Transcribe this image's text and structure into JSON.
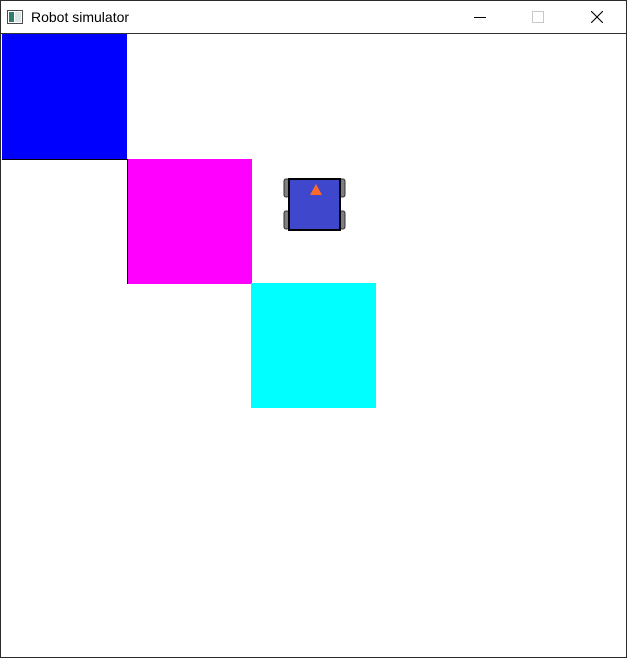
{
  "window": {
    "title": "Robot simulator",
    "controls": {
      "minimize": "minimize-icon",
      "maximize": "maximize-icon",
      "close": "close-icon"
    }
  },
  "world": {
    "tiles": [
      {
        "name": "blue",
        "color": "#0000ff"
      },
      {
        "name": "magenta",
        "color": "#ff00ff"
      },
      {
        "name": "cyan",
        "color": "#00ffff"
      }
    ],
    "robot": {
      "body_color": "#3f48cc",
      "wheel_color": "#7f7f7f",
      "heading_marker_color": "#ff6a2a",
      "heading": "up"
    }
  }
}
